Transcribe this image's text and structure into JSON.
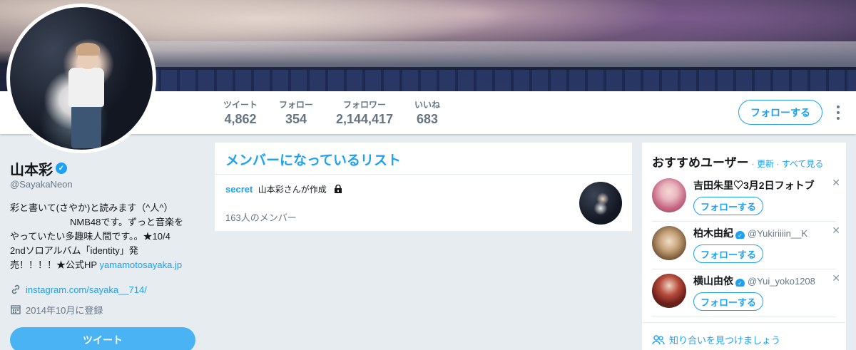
{
  "nav": {
    "stats": [
      {
        "label": "ツイート",
        "value": "4,862"
      },
      {
        "label": "フォロー",
        "value": "354"
      },
      {
        "label": "フォロワー",
        "value": "2,144,417"
      },
      {
        "label": "いいね",
        "value": "683"
      }
    ],
    "follow_button": "フォローする"
  },
  "profile": {
    "name": "山本彩",
    "handle": "@SayakaNeon",
    "bio_lines": [
      "彩と書いて(さやか)と読みます（^人^）",
      "NMB48です。ずっと音楽を",
      "やっていたい多趣味人間です。。★10/4",
      "2ndソロアルバム「identity」発",
      "売！！！！★公式HP "
    ],
    "bio_link": "yamamotosayaka.jp",
    "website": "instagram.com/sayaka__714/",
    "joined": "2014年10月に登録",
    "tweet_button": "ツイート"
  },
  "lists": {
    "title": "メンバーになっているリスト",
    "items": [
      {
        "name": "secret",
        "creator": "山本彩さんが作成",
        "members": "163人のメンバー"
      }
    ]
  },
  "recommended": {
    "title": "おすすめユーザー",
    "refresh": "更新",
    "separator": "·",
    "view_all": "すべて見る",
    "users": [
      {
        "name": "吉田朱里♡3月2日フォトブ",
        "handle": "",
        "verified": false,
        "follow": "フォローする"
      },
      {
        "name": "柏木由紀",
        "handle": "@Yukiriiiin__K",
        "verified": true,
        "follow": "フォローする"
      },
      {
        "name": "横山由依",
        "handle": "@Yui_yoko1208",
        "verified": true,
        "follow": "フォローする"
      }
    ],
    "find_friends": "知り合いを見つけましょう"
  },
  "colors": {
    "accent": "#1da1f2",
    "background": "#e6ecf0",
    "tweet_button": "#4ab3f4"
  }
}
